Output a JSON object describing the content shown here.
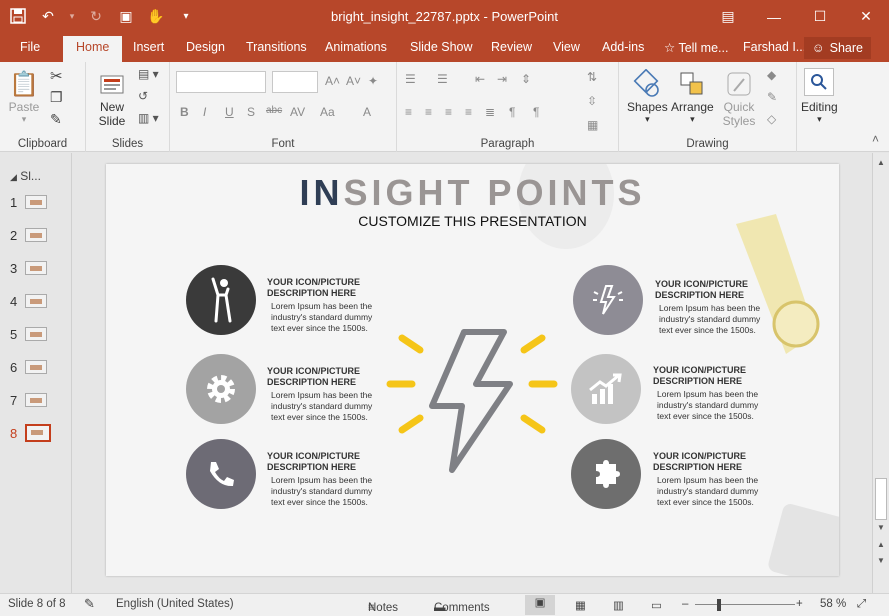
{
  "window": {
    "title": "bright_insight_22787.pptx - PowerPoint",
    "controls": [
      "restore-icon",
      "minimize-icon",
      "maximize-icon",
      "close-icon"
    ]
  },
  "ribbon_tabs": [
    "File",
    "Home",
    "Insert",
    "Design",
    "Transitions",
    "Animations",
    "Slide Show",
    "Review",
    "View",
    "Add-ins",
    "Tell me...",
    "Farshad I..."
  ],
  "active_tab": "Home",
  "share_label": "Share",
  "ribbon": {
    "clipboard": {
      "label": "Clipboard",
      "paste": "Paste"
    },
    "slides": {
      "label": "Slides",
      "new_slide": "New Slide"
    },
    "font": {
      "label": "Font"
    },
    "paragraph": {
      "label": "Paragraph"
    },
    "drawing": {
      "label": "Drawing",
      "shapes": "Shapes",
      "arrange": "Arrange",
      "quick_styles": "Quick Styles"
    },
    "editing": {
      "label": "Editing"
    }
  },
  "thumb_pane": {
    "heading": "Sl...",
    "slides": [
      "1",
      "2",
      "3",
      "4",
      "5",
      "6",
      "7",
      "8"
    ],
    "current": "8"
  },
  "slide": {
    "title_highlight": "IN",
    "title_rest": "SIGHT POINTS",
    "subtitle": "CUSTOMIZE THIS PRESENTATION",
    "items": [
      {
        "heading": "YOUR ICON/PICTURE DESCRIPTION HERE",
        "body": "Lorem Ipsum has been the industry's standard dummy text ever since the 1500s."
      },
      {
        "heading": "YOUR ICON/PICTURE DESCRIPTION HERE",
        "body": "Lorem Ipsum has been the industry's standard dummy text ever since the 1500s."
      },
      {
        "heading": "YOUR ICON/PICTURE DESCRIPTION HERE",
        "body": "Lorem Ipsum has been the industry's standard dummy text ever since the 1500s."
      },
      {
        "heading": "YOUR ICON/PICTURE DESCRIPTION HERE",
        "body": "Lorem Ipsum has been the industry's standard dummy text ever since the 1500s."
      },
      {
        "heading": "YOUR ICON/PICTURE DESCRIPTION HERE",
        "body": "Lorem Ipsum has been the industry's standard dummy text ever since the 1500s."
      },
      {
        "heading": "YOUR ICON/PICTURE DESCRIPTION HERE",
        "body": "Lorem Ipsum has been the industry's standard dummy text ever since the 1500s."
      }
    ],
    "colors": {
      "dark": "#3a3a3a",
      "mid": "#a3a3a3",
      "slate": "#6d6b75",
      "light_purple": "#8e8c95",
      "light": "#c3c3c3",
      "gray": "#6e6e6e",
      "accent_yellow": "#f5c518"
    }
  },
  "status_bar": {
    "slide_info": "Slide 8 of 8",
    "language": "English (United States)",
    "notes": "Notes",
    "comments": "Comments",
    "zoom": "58 %"
  }
}
